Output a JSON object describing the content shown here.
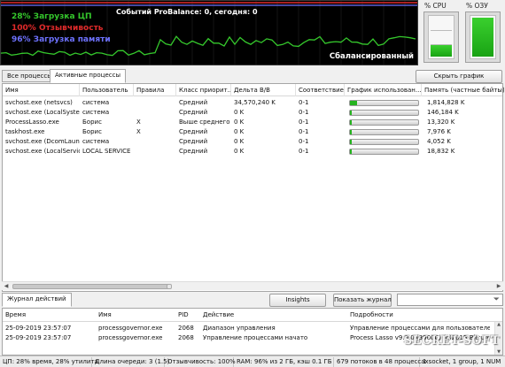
{
  "graph": {
    "cpu_label": "28% Загрузка ЦП",
    "responsiveness_label": "100% Отзывчивость",
    "memory_label": "96% Загрузка памяти",
    "events_label": "Событий ProBalance: 0, сегодня: 0",
    "balanced_label": "Сбалансированный",
    "colors": {
      "cpu": "#35c82c",
      "responsiveness": "#e02a2a",
      "memory": "#6e72ff"
    }
  },
  "meters": {
    "cpu": {
      "title": "% CPU",
      "fill_fraction": 0.28
    },
    "ram": {
      "title": "% ОЗУ",
      "fill_fraction": 0.96
    }
  },
  "tabs": {
    "all": "Все процессы",
    "active": "Активные процессы"
  },
  "hide_graph_button": "Скрыть график",
  "process_table": {
    "columns": [
      "Имя",
      "Пользователь",
      "Правила",
      "Класс приорит...",
      "Дельта В/В",
      "Соответствие...",
      "График использован...",
      "Память (частные байты)"
    ],
    "rows": [
      {
        "name": "svchost.exe (netsvcs)",
        "user": "система",
        "rules": "",
        "priority": "Средний",
        "io_delta": "34,570,240 K",
        "affinity": "0-1",
        "usage": 0.1,
        "memory": "1,814,828 K"
      },
      {
        "name": "svchost.exe (LocalSyste...",
        "user": "система",
        "rules": "",
        "priority": "Средний",
        "io_delta": "0 K",
        "affinity": "0-1",
        "usage": 0.03,
        "memory": "146,184 K"
      },
      {
        "name": "ProcessLasso.exe",
        "user": "Борис",
        "rules": "X",
        "priority": "Выше среднего",
        "io_delta": "0 K",
        "affinity": "0-1",
        "usage": 0.02,
        "memory": "13,320 K"
      },
      {
        "name": "taskhost.exe",
        "user": "Борис",
        "rules": "X",
        "priority": "Средний",
        "io_delta": "0 K",
        "affinity": "0-1",
        "usage": 0.02,
        "memory": "7,976 K"
      },
      {
        "name": "svchost.exe (DcomLaun...",
        "user": "система",
        "rules": "",
        "priority": "Средний",
        "io_delta": "0 K",
        "affinity": "0-1",
        "usage": 0.02,
        "memory": "4,052 K"
      },
      {
        "name": "svchost.exe (LocalServic...",
        "user": "LOCAL SERVICE",
        "rules": "",
        "priority": "Средний",
        "io_delta": "0 K",
        "affinity": "0-1",
        "usage": 0.02,
        "memory": "18,832 K"
      }
    ]
  },
  "log": {
    "tab": "Журнал действий",
    "insights_button": "Insights",
    "show_log_button": "Показать журнал",
    "search_placeholder": "",
    "columns": [
      "Время",
      "Имя",
      "PID",
      "Действие",
      "Подробности"
    ],
    "rows": [
      {
        "time": "25-09-2019 23:57:07",
        "name": "processgovernor.exe",
        "pid": "2068",
        "action": "Диапазон управления",
        "details": "Управление процессами для пользователей: ..."
      },
      {
        "time": "25-09-2019 23:57:07",
        "name": "processgovernor.exe",
        "pid": "2068",
        "action": "Управление процессами начато",
        "details": "Process Lasso v9.0.0 (3000C) (c)2015 Bitsum..."
      }
    ]
  },
  "status": {
    "cpu": "ЦП: 28% время, 28% утилита",
    "queue": "Длина очереди: 3 (1.5)",
    "responsiveness": "Отзывчивость: 100%",
    "ram": "RAM: 96% из 2 ГБ, кэш 0.1 ГБ",
    "threads": "679 потоков в 48 процессах",
    "sockets": "1 socket, 1 group, 1 NUM"
  },
  "watermark": "SECRET-SOFT"
}
